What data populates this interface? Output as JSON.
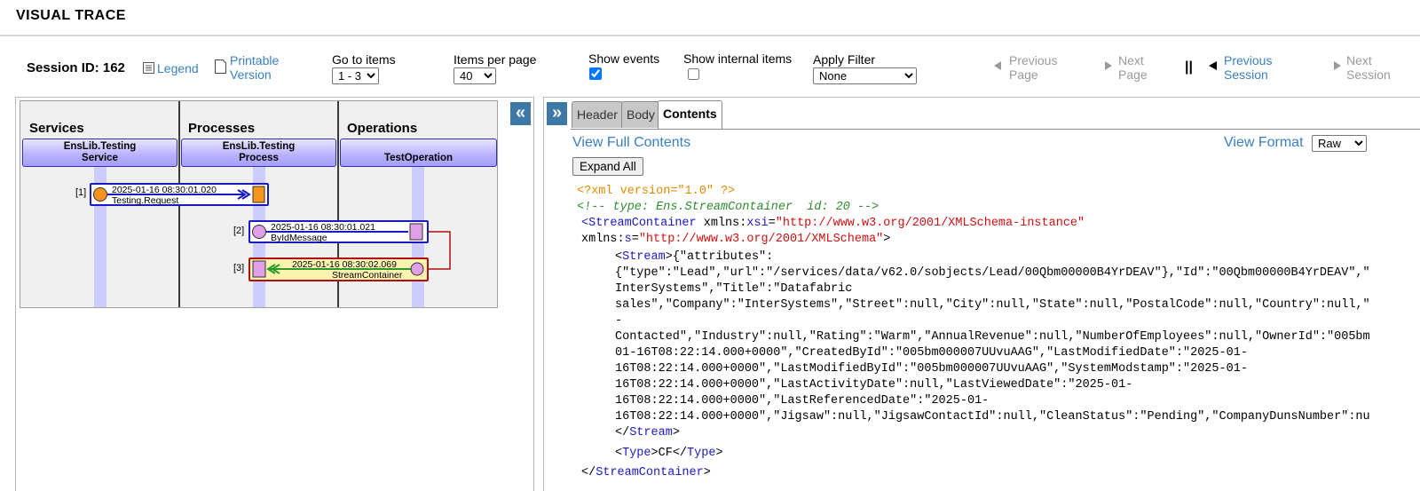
{
  "page_title": "VISUAL TRACE",
  "toolbar": {
    "session_label": "Session ID: 162",
    "legend_label": "Legend",
    "printable_line1": "Printable",
    "printable_line2": "Version",
    "goto_label": "Go to items",
    "goto_value": "1 - 3",
    "per_page_label": "Items per page",
    "per_page_value": "40",
    "show_events_label": "Show events",
    "show_events_checked": true,
    "show_internal_label": "Show internal items",
    "show_internal_checked": false,
    "filter_label": "Apply Filter",
    "filter_value": "None",
    "prev_page_line1": "Previous",
    "prev_page_line2": "Page",
    "next_page_line1": "Next",
    "next_page_line2": "Page",
    "pause_glyph": "||",
    "prev_session_line1": "Previous",
    "prev_session_line2": "Session",
    "next_session_line1": "Next",
    "next_session_line2": "Session",
    "colors": {
      "link": "#3a7fc1",
      "disabled": "#9a9a9a"
    }
  },
  "left_panel": {
    "collapse_glyph": "«",
    "columns": [
      {
        "header": "Services",
        "lane_line1": "EnsLib.Testing",
        "lane_line2": "Service"
      },
      {
        "header": "Processes",
        "lane_line1": "EnsLib.Testing",
        "lane_line2": "Process"
      },
      {
        "header": "Operations",
        "lane_line1": "",
        "lane_line2": "TestOperation"
      }
    ],
    "messages": [
      {
        "num": "[1]",
        "time": "2025-01-16 08:30:01.020",
        "name": "Testing.Request"
      },
      {
        "num": "[2]",
        "time": "2025-01-16 08:30:01.021",
        "name": "ByIdMessage"
      },
      {
        "num": "[3]",
        "time": "2025-01-16 08:30:02.069",
        "name": "StreamContainer"
      }
    ]
  },
  "right_panel": {
    "expand_glyph": "»",
    "tabs": [
      "Header",
      "Body",
      "Contents"
    ],
    "active_tab": "Contents",
    "view_full_contents": "View Full Contents",
    "view_format_label": "View Format",
    "view_format_value": "Raw",
    "expand_all_label": "Expand All",
    "xml": {
      "pi": "<?xml version=\"1.0\" ?>",
      "comment": "<!-- type: Ens.StreamContainer  id: 20 -->",
      "root_tag": "StreamContainer",
      "ns1_attr": "xmlns:",
      "ns1_prefix": "xsi",
      "ns1_value": "\"http://www.w3.org/2001/XMLSchema-instance\"",
      "ns2_attr": "xmlns:",
      "ns2_prefix": "s",
      "ns2_value": "\"http://www.w3.org/2001/XMLSchema\"",
      "stream_tag": "Stream",
      "stream_lines": [
        "{\"attributes\":",
        "{\"type\":\"Lead\",\"url\":\"/services/data/v62.0/sobjects/Lead/00Qbm00000B4YrDEAV\"},\"Id\":\"00Qbm00000B4YrDEAV\",\"",
        "InterSystems\",\"Title\":\"Datafabric",
        "sales\",\"Company\":\"InterSystems\",\"Street\":null,\"City\":null,\"State\":null,\"PostalCode\":null,\"Country\":null,\"",
        "-",
        "Contacted\",\"Industry\":null,\"Rating\":\"Warm\",\"AnnualRevenue\":null,\"NumberOfEmployees\":null,\"OwnerId\":\"005bm",
        "01-16T08:22:14.000+0000\",\"CreatedById\":\"005bm000007UUvuAAG\",\"LastModifiedDate\":\"2025-01-",
        "16T08:22:14.000+0000\",\"LastModifiedById\":\"005bm000007UUvuAAG\",\"SystemModstamp\":\"2025-01-",
        "16T08:22:14.000+0000\",\"LastActivityDate\":null,\"LastViewedDate\":\"2025-01-",
        "16T08:22:14.000+0000\",\"LastReferencedDate\":\"2025-01-",
        "16T08:22:14.000+0000\",\"Jigsaw\":null,\"JigsawContactId\":null,\"CleanStatus\":\"Pending\",\"CompanyDunsNumber\":nu"
      ],
      "type_tag": "Type",
      "type_value": "CF"
    }
  }
}
